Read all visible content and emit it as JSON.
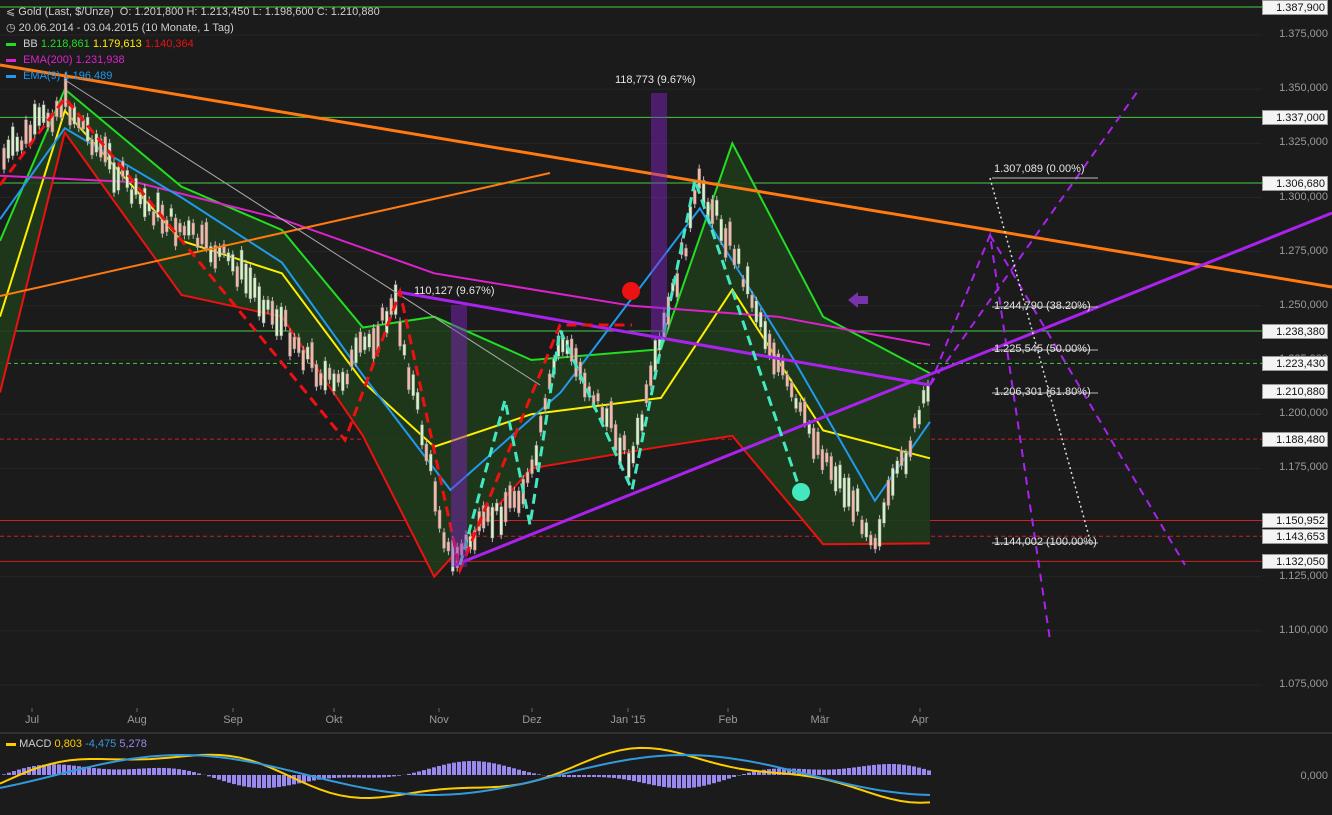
{
  "header": {
    "title": "Gold (Last, $/Unze)",
    "ohlc": "O: 1.201,800  H: 1.213,450  L: 1.198,600  C: 1.210,880",
    "period": "20.06.2014 - 03.04.2015 (10 Monate, 1 Tag)"
  },
  "legend": {
    "bb": {
      "label": "BB",
      "v1": "1.218,861",
      "v2": "1.179,613",
      "v3": "1.140,364"
    },
    "ema200": {
      "label": "EMA(200)",
      "value": "1.231,938"
    },
    "ema9": {
      "label": "EMA(9)",
      "value": "1.196,489"
    }
  },
  "macd_legend": {
    "label": "MACD",
    "v1": "0,803",
    "v2": "-4,475",
    "v3": "5,278"
  },
  "colors": {
    "bb_upper": "#22dd22",
    "bb_mid": "#ffee00",
    "bb_lower": "#ee1111",
    "ema200": "#dd22cc",
    "ema9": "#2299ee",
    "trend": "#ff7a10",
    "pattern": "#aa22ee",
    "macd": "#ffcc00",
    "signal": "#3399dd",
    "hist": "#9988ee"
  },
  "y_ticks": [
    "1.375,000",
    "1.350,000",
    "1.325,000",
    "1.300,000",
    "1.275,000",
    "1.250,000",
    "1.225,000",
    "1.200,000",
    "1.175,000",
    "1.125,000",
    "1.100,000",
    "1.075,000"
  ],
  "x_ticks": [
    "Jul",
    "Aug",
    "Sep",
    "Okt",
    "Nov",
    "Dez",
    "Jan '15",
    "Feb",
    "Mär",
    "Apr"
  ],
  "price_tags": [
    "1.387,900",
    "1.337,000",
    "1.306,680",
    "1.238,380",
    "1.223,430",
    "1.210,880",
    "1.188,480",
    "1.150,952",
    "1.143,653",
    "1.132,050"
  ],
  "annotations": {
    "move1": "118,773 (9.67%)",
    "move2": "110,127 (9.67%)"
  },
  "fib_labels": [
    "1.307,089 (0.00%)",
    "1.244,790 (38.20%)",
    "1.225,545 (50.00%)",
    "1.206,301 (61.80%)",
    "1.144,002 (100.00%)"
  ],
  "macd_zero": "0,000",
  "chart_data": {
    "type": "line",
    "title": "Gold (Last, $/Unze)",
    "ylim": [
      1075,
      1390
    ],
    "x_range": [
      "2014-06-20",
      "2015-04-03"
    ],
    "series": [
      {
        "name": "Gold",
        "dates": [
          "2014-06-20",
          "2014-07-10",
          "2014-08-01",
          "2014-09-01",
          "2014-10-01",
          "2014-10-20",
          "2014-11-06",
          "2014-12-01",
          "2014-12-10",
          "2015-01-01",
          "2015-01-22",
          "2015-02-01",
          "2015-02-20",
          "2015-03-17",
          "2015-04-03"
        ],
        "values": [
          1316,
          1345,
          1300,
          1268,
          1212,
          1250,
          1132,
          1170,
          1236,
          1178,
          1306,
          1278,
          1205,
          1143,
          1210.88
        ]
      },
      {
        "name": "BB",
        "dates": [
          "2014-06-20",
          "2014-07-10",
          "2014-08-15",
          "2014-09-15",
          "2014-10-10",
          "2014-11-01",
          "2014-12-01",
          "2015-01-10",
          "2015-02-01",
          "2015-03-01",
          "2015-04-03"
        ],
        "values": [
          1280,
          1350,
          1305,
          1285,
          1240,
          1245,
          1225,
          1230,
          1325,
          1245,
          1218.861
        ]
      },
      {
        "name": "EMA(200)",
        "dates": [
          "2014-06-20",
          "2014-08-01",
          "2014-09-15",
          "2014-11-01",
          "2015-01-01",
          "2015-02-15",
          "2015-04-03"
        ],
        "values": [
          1310,
          1307,
          1290,
          1265,
          1250,
          1245,
          1231.938
        ]
      },
      {
        "name": "EMA(9)",
        "dates": [
          "2014-06-20",
          "2014-07-10",
          "2014-08-15",
          "2014-09-15",
          "2014-10-10",
          "2014-11-06",
          "2014-12-10",
          "2015-01-22",
          "2015-02-20",
          "2015-03-17",
          "2015-04-03"
        ],
        "values": [
          1290,
          1332,
          1300,
          1270,
          1218,
          1165,
          1210,
          1295,
          1225,
          1160,
          1196.489
        ]
      }
    ],
    "macd": [
      {
        "name": "MACD",
        "value": 0.803
      },
      {
        "name": "",
        "value": -4.475
      },
      {
        "name": "",
        "value": 5.278
      }
    ]
  }
}
